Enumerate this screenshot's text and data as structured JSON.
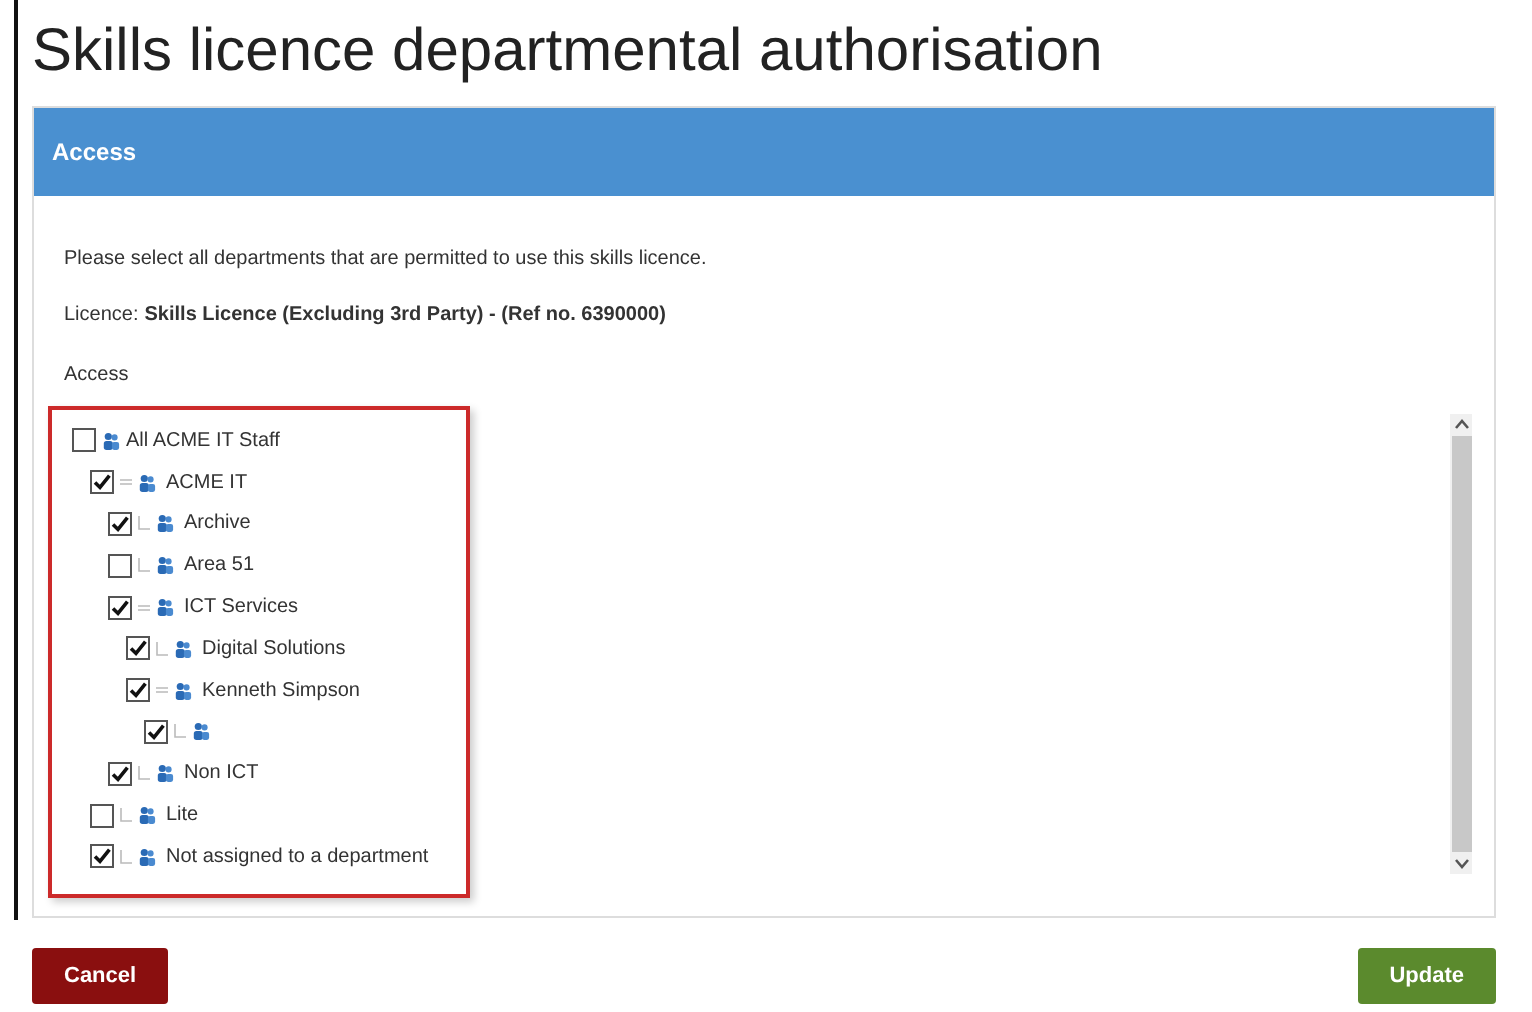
{
  "page_title": "Skills licence departmental authorisation",
  "panel": {
    "title": "Access",
    "instruction": "Please select all departments that are permitted to use this skills licence.",
    "licence_label": "Licence:",
    "licence_value": "Skills Licence (Excluding 3rd Party) - (Ref no. 6390000)",
    "access_label": "Access"
  },
  "tree": [
    {
      "label": "All ACME IT Staff",
      "checked": false,
      "children": [
        {
          "label": "ACME IT",
          "checked": true,
          "children": [
            {
              "label": "Archive",
              "checked": true
            },
            {
              "label": "Area 51",
              "checked": false
            },
            {
              "label": "ICT Services",
              "checked": true,
              "children": [
                {
                  "label": "Digital Solutions",
                  "checked": true
                },
                {
                  "label": "Kenneth Simpson",
                  "checked": true,
                  "children": [
                    {
                      "checked": true
                    }
                  ]
                }
              ]
            },
            {
              "label": "Non ICT",
              "checked": true
            }
          ]
        },
        {
          "label": "Lite",
          "checked": false
        },
        {
          "label": "Not assigned to a department",
          "checked": true
        }
      ]
    }
  ],
  "buttons": [
    {
      "label": "Cancel",
      "kind": "cancel"
    },
    {
      "label": "Update",
      "kind": "primary"
    }
  ]
}
